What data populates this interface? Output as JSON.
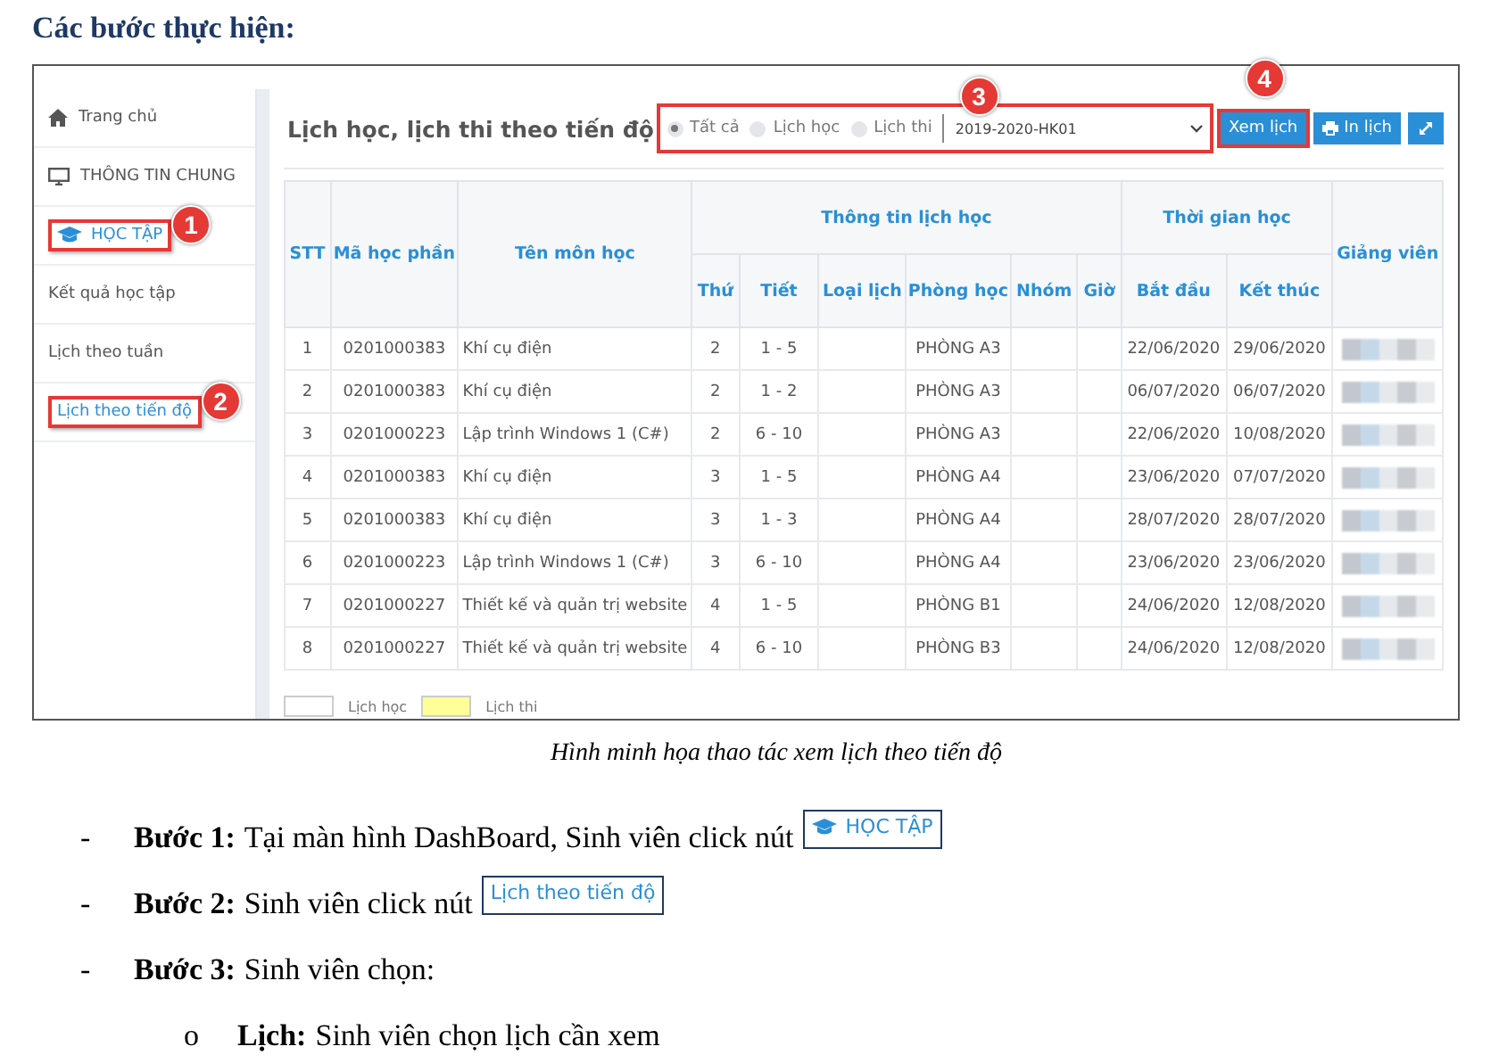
{
  "heading": "Các bước thực hiện:",
  "figure": {
    "sidebar": {
      "items": [
        {
          "label": "Trang chủ",
          "kind": "home",
          "selected": false
        },
        {
          "label": "THÔNG TIN CHUNG",
          "kind": "monitor",
          "selected": false
        },
        {
          "label": "HỌC TẬP",
          "kind": "cap",
          "selected": true,
          "annotation": "1"
        },
        {
          "label": "Kết quả học tập",
          "selected": false
        },
        {
          "label": "Lịch theo tuần",
          "selected": false
        },
        {
          "label": "Lịch theo tiến độ",
          "selected": true,
          "annotation": "2"
        }
      ]
    },
    "title": "Lịch học, lịch thi theo tiến độ",
    "filter": {
      "annotation": "3",
      "options": [
        {
          "label": "Tất cả",
          "selected": true
        },
        {
          "label": "Lịch học",
          "selected": false
        },
        {
          "label": "Lịch thi",
          "selected": false
        }
      ],
      "semester": "2019-2020-HK01"
    },
    "buttons": [
      {
        "kind": "view",
        "label": "Xem lịch",
        "annotation": "4"
      },
      {
        "kind": "print",
        "label": "In lịch"
      },
      {
        "kind": "expand"
      }
    ],
    "table": {
      "columns": [
        {
          "label": "STT"
        },
        {
          "label": "Mã học phần"
        },
        {
          "label": "Tên môn học"
        },
        {
          "label": "Thông tin lịch học",
          "colspan": 6,
          "children": [
            {
              "label": "Thứ"
            },
            {
              "label": "Tiết"
            },
            {
              "label": "Loại lịch"
            },
            {
              "label": "Phòng học"
            },
            {
              "label": "Nhóm"
            },
            {
              "label": "Giờ"
            }
          ]
        },
        {
          "label": "Thời gian học",
          "colspan": 2,
          "children": [
            {
              "label": "Bắt đầu"
            },
            {
              "label": "Kết thúc"
            }
          ]
        },
        {
          "label": "Giảng viên"
        }
      ],
      "rows": [
        [
          "1",
          "0201000383",
          "Khí cụ điện",
          "2",
          "1 - 5",
          "",
          "PHÒNG A3",
          "",
          "",
          "22/06/2020",
          "29/06/2020"
        ],
        [
          "2",
          "0201000383",
          "Khí cụ điện",
          "2",
          "1 - 2",
          "",
          "PHÒNG A3",
          "",
          "",
          "06/07/2020",
          "06/07/2020"
        ],
        [
          "3",
          "0201000223",
          "Lập trình Windows 1 (C#)",
          "2",
          "6 - 10",
          "",
          "PHÒNG A3",
          "",
          "",
          "22/06/2020",
          "10/08/2020"
        ],
        [
          "4",
          "0201000383",
          "Khí cụ điện",
          "3",
          "1 - 5",
          "",
          "PHÒNG A4",
          "",
          "",
          "23/06/2020",
          "07/07/2020"
        ],
        [
          "5",
          "0201000383",
          "Khí cụ điện",
          "3",
          "1 - 3",
          "",
          "PHÒNG A4",
          "",
          "",
          "28/07/2020",
          "28/07/2020"
        ],
        [
          "6",
          "0201000223",
          "Lập trình Windows 1 (C#)",
          "3",
          "6 - 10",
          "",
          "PHÒNG A4",
          "",
          "",
          "23/06/2020",
          "23/06/2020"
        ],
        [
          "7",
          "0201000227",
          "Thiết kế và quản trị website",
          "4",
          "1 - 5",
          "",
          "PHÒNG B1",
          "",
          "",
          "24/06/2020",
          "12/08/2020"
        ],
        [
          "8",
          "0201000227",
          "Thiết kế và quản trị website",
          "4",
          "6 - 10",
          "",
          "PHÒNG B3",
          "",
          "",
          "24/06/2020",
          "12/08/2020"
        ]
      ]
    },
    "legend": [
      {
        "label": "Lịch học",
        "color": "#ffffff"
      },
      {
        "label": "Lịch thi",
        "color": "#ffff99"
      }
    ]
  },
  "caption": "Hình minh họa thao tác xem lịch theo tiến độ",
  "steps": [
    {
      "kind": "dash",
      "marker": "-",
      "label": "Bước 1:",
      "text": "Tại màn hình DashBoard, Sinh viên click nút",
      "button": {
        "label": "HỌC TẬP",
        "kind": "cap"
      }
    },
    {
      "kind": "dash",
      "marker": "-",
      "label": "Bước 2:",
      "text": "Sinh viên click nút",
      "button": {
        "label": "Lịch theo tiến độ"
      }
    },
    {
      "kind": "dash",
      "marker": "-",
      "label": "Bước 3:",
      "text": "Sinh viên chọn:"
    },
    {
      "kind": "circle",
      "marker": "o",
      "label": "Lịch:",
      "text": "Sinh viên chọn lịch cần xem"
    }
  ]
}
